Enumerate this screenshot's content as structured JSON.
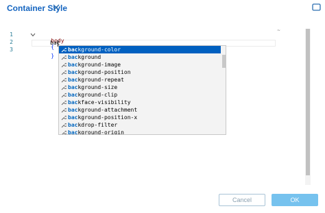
{
  "header": {
    "title": "Container Style"
  },
  "editor": {
    "line_numbers": [
      "1",
      "2",
      "3"
    ],
    "line1_selector": "body",
    "line1_brace": "{",
    "line2_text": "bac",
    "line3_brace": "}",
    "ruler_mark": "~"
  },
  "suggestions": {
    "typed": "bac",
    "items": [
      {
        "match": "bac",
        "rest": "kground-color"
      },
      {
        "match": "bac",
        "rest": "kground"
      },
      {
        "match": "bac",
        "rest": "kground-image"
      },
      {
        "match": "bac",
        "rest": "kground-position"
      },
      {
        "match": "bac",
        "rest": "kground-repeat"
      },
      {
        "match": "bac",
        "rest": "kground-size"
      },
      {
        "match": "bac",
        "rest": "kground-clip"
      },
      {
        "match": "bac",
        "rest": "kface-visibility"
      },
      {
        "match": "bac",
        "rest": "kground-attachment"
      },
      {
        "match": "bac",
        "rest": "kground-position-x"
      },
      {
        "match": "bac",
        "rest": "kdrop-filter"
      },
      {
        "match": "bac",
        "rest": "kground-origin"
      }
    ],
    "selected_index": 0,
    "icon": "wrench-icon"
  },
  "footer": {
    "cancel_label": "Cancel",
    "ok_label": "OK"
  },
  "colors": {
    "title": "#1565c0",
    "selected_bg": "#0060c0",
    "ok_bg": "#76c2ee"
  }
}
